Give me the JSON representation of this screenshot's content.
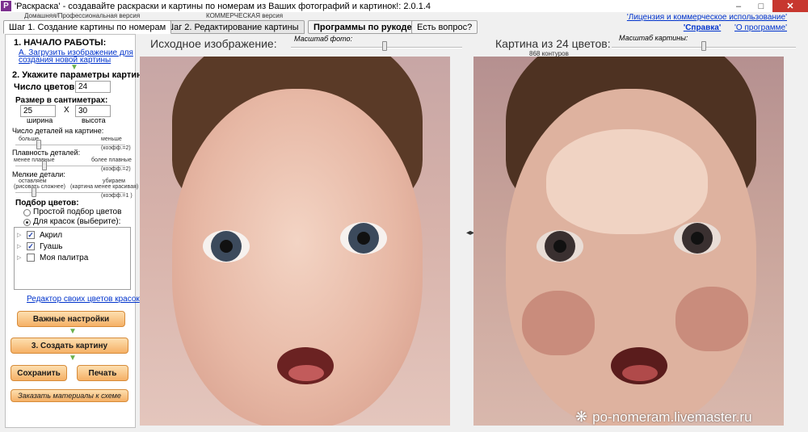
{
  "window": {
    "title": "'Раскраска' - создавайте раскраски и картины по номерам из Ваших фотографий и картинок!: 2.0.1.4",
    "icon_letter": "P",
    "minimize": "–",
    "maximize": "□",
    "close": "✕"
  },
  "editions": {
    "home": "Домашняя/Профессиональная версия",
    "commercial": "КОММЕРЧЕСКАЯ версия"
  },
  "top_links": {
    "license": "'Лицензия и коммерческое использование'",
    "help": "'Справка'",
    "about": "'О программе'"
  },
  "tabs": {
    "step1": "Шаг 1. Создание картины по номерам",
    "step2": "Шаг 2. Редактирование картины",
    "programs": "Программы по рукоделию!",
    "question": "Есть вопрос?"
  },
  "left": {
    "start_heading": "1. НАЧАЛО РАБОТЫ:",
    "load_link_line1": "А. Загрузить изображение для",
    "load_link_line2": "создания новой картины",
    "params_heading": "2. Укажите параметры картины",
    "colors_label": "Число цветов:",
    "colors_value": "24",
    "size_label": "Размер в сантиметрах:",
    "width_value": "25",
    "x_label": "X",
    "height_value": "30",
    "width_caption": "ширина",
    "height_caption": "высота",
    "detail_label": "Число деталей на картине:",
    "detail_more": "больше",
    "detail_less": "меньше",
    "detail_coef": "(коэфф.=2)",
    "detail_level": 0.2,
    "smooth_label": "Плавность деталей:",
    "smooth_less": "менее плавные",
    "smooth_more": "более плавные",
    "smooth_coef": "(коэфф.=2)",
    "smooth_level": 0.25,
    "small_label": "Мелкие детали:",
    "small_leave_1": "оставляем",
    "small_leave_2": "(рисовать сложнее)",
    "small_remove_1": "убираем",
    "small_remove_2": "(картина менее красивая)",
    "small_coef": "(коэфф.=1 )",
    "small_level": 0.15,
    "color_select_heading": "Подбор цветов:",
    "radio_simple": "Простой подбор цветов",
    "radio_paints": "Для красок (выберите):",
    "palettes": [
      {
        "label": "Акрил",
        "checked": true
      },
      {
        "label": "Гуашь",
        "checked": true
      },
      {
        "label": "Моя палитра",
        "checked": false
      }
    ],
    "editor_link": "Редактор своих цветов красок",
    "important_btn": "Важные настройки",
    "create_btn": "3. Создать картину",
    "save_btn": "Сохранить",
    "print_btn": "Печать",
    "order_btn": "Заказать материалы к схеме"
  },
  "source": {
    "title": "Исходное изображение:",
    "scale_label": "Масштаб фото:",
    "scale_level": 0.55
  },
  "result": {
    "title": "Картина из 24 цветов:",
    "contours": "868 контуров",
    "scale_label": "Масштаб картины:",
    "scale_level": 0.5
  },
  "watermark": "po-nomeram.livemaster.ru",
  "colors": {
    "accent_orange": "#f5b066",
    "link_blue": "#0033cc",
    "close_red": "#c7372f"
  }
}
